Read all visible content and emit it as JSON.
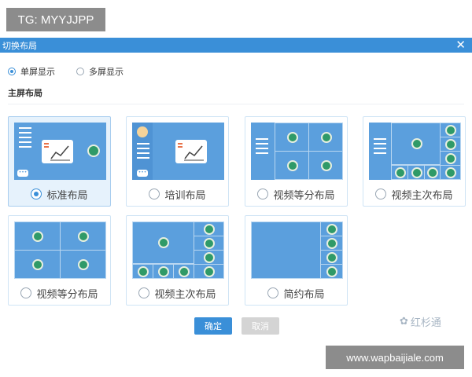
{
  "overlay": {
    "tg_label": "TG: MYYJJPP",
    "website": "www.wapbaijiale.com"
  },
  "dialog": {
    "title": "切换布局",
    "close_glyph": "✕",
    "screen_modes": [
      {
        "label": "单屏显示",
        "selected": true
      },
      {
        "label": "多屏显示",
        "selected": false
      }
    ],
    "section_title": "主屏布局",
    "layouts": [
      {
        "label": "标准布局",
        "selected": true
      },
      {
        "label": "培训布局",
        "selected": false
      },
      {
        "label": "视频等分布局",
        "selected": false
      },
      {
        "label": "视频主次布局",
        "selected": false
      },
      {
        "label": "视频等分布局",
        "selected": false
      },
      {
        "label": "视频主次布局",
        "selected": false
      },
      {
        "label": "简约布局",
        "selected": false
      }
    ],
    "ok_label": "确定",
    "cancel_label": "取消"
  },
  "watermark": {
    "text": "红杉通"
  },
  "colors": {
    "accent": "#3a8fd8",
    "preview_bg": "#5b9fdd",
    "camera": "#2f9a68"
  },
  "icons": [
    "close-icon",
    "camera-icon",
    "chat-icon",
    "whiteboard-icon",
    "avatar-icon",
    "list-icon"
  ]
}
